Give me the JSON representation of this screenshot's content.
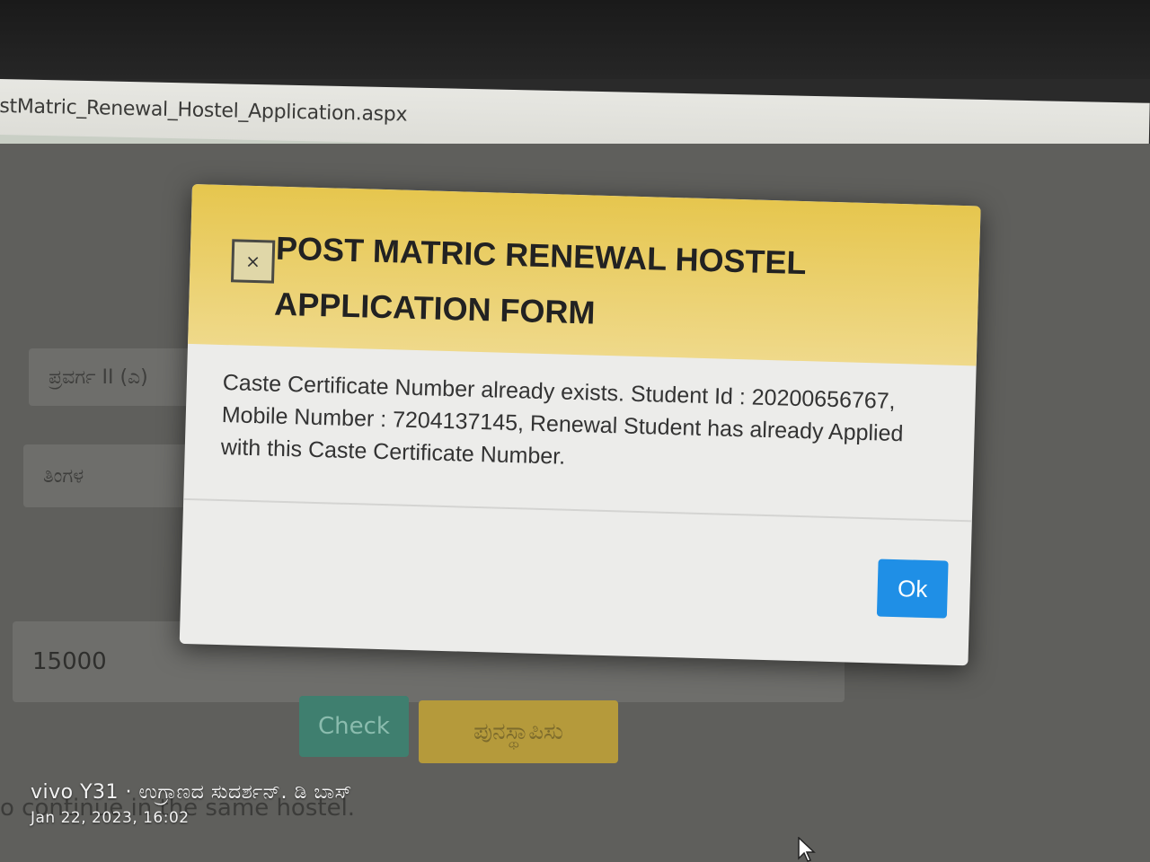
{
  "browser": {
    "url_fragment": "stMatric_Renewal_Hostel_Application.aspx"
  },
  "page": {
    "caste_field_value": "ಪ್ರವರ್ಗ II (ಎ)",
    "month_field_value": "ತಿಂಗಳ",
    "amount_field_value": "15000",
    "check_button_label": "Check",
    "restore_button_label": "ಪುನಸ್ಥಾಪಿಸು",
    "bottom_text": "o continue in the same hostel."
  },
  "modal": {
    "title": "POST MATRIC RENEWAL HOSTEL APPLICATION FORM",
    "close_label": "×",
    "message": "Caste Certificate Number already exists. Student Id : 20200656767, Mobile Number : 7204137145, Renewal Student has already Applied with this Caste Certificate Number.",
    "ok_label": "Ok",
    "accent_color": "#1f8fe6",
    "header_color": "#e6c64e"
  },
  "watermark": {
    "line1": "vivo Y31 · ಉಗ್ರಾಣದ ಸುದರ್ಶನ್. ಡಿ ಬಾಸ್",
    "line2": "Jan 22, 2023, 16:02"
  }
}
